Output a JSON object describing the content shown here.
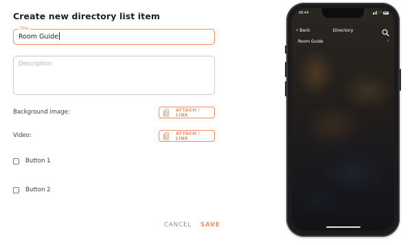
{
  "form": {
    "heading": "Create new directory list item",
    "title_label": "Title",
    "title_value": "Room Guide",
    "description_placeholder": "Description",
    "background_label": "Background image:",
    "video_label": "Video:",
    "attach_label": "ATTACH / LINK",
    "buttons": [
      {
        "label": "Button 1",
        "checked": false
      },
      {
        "label": "Button 2",
        "checked": false
      }
    ],
    "cancel_label": "CANCEL",
    "save_label": "SAVE"
  },
  "phone": {
    "status_time": "08:44",
    "back_label": "Back",
    "nav_title": "Directory",
    "list_items": [
      "Room Guide"
    ]
  },
  "colors": {
    "accent": "#f08a5d",
    "text": "#333333",
    "muted": "#8a8a8a"
  },
  "icons": {
    "attach": "paperclip-icon",
    "search": "search-icon",
    "back": "chevron-left-icon",
    "item": "chevron-right-icon"
  }
}
